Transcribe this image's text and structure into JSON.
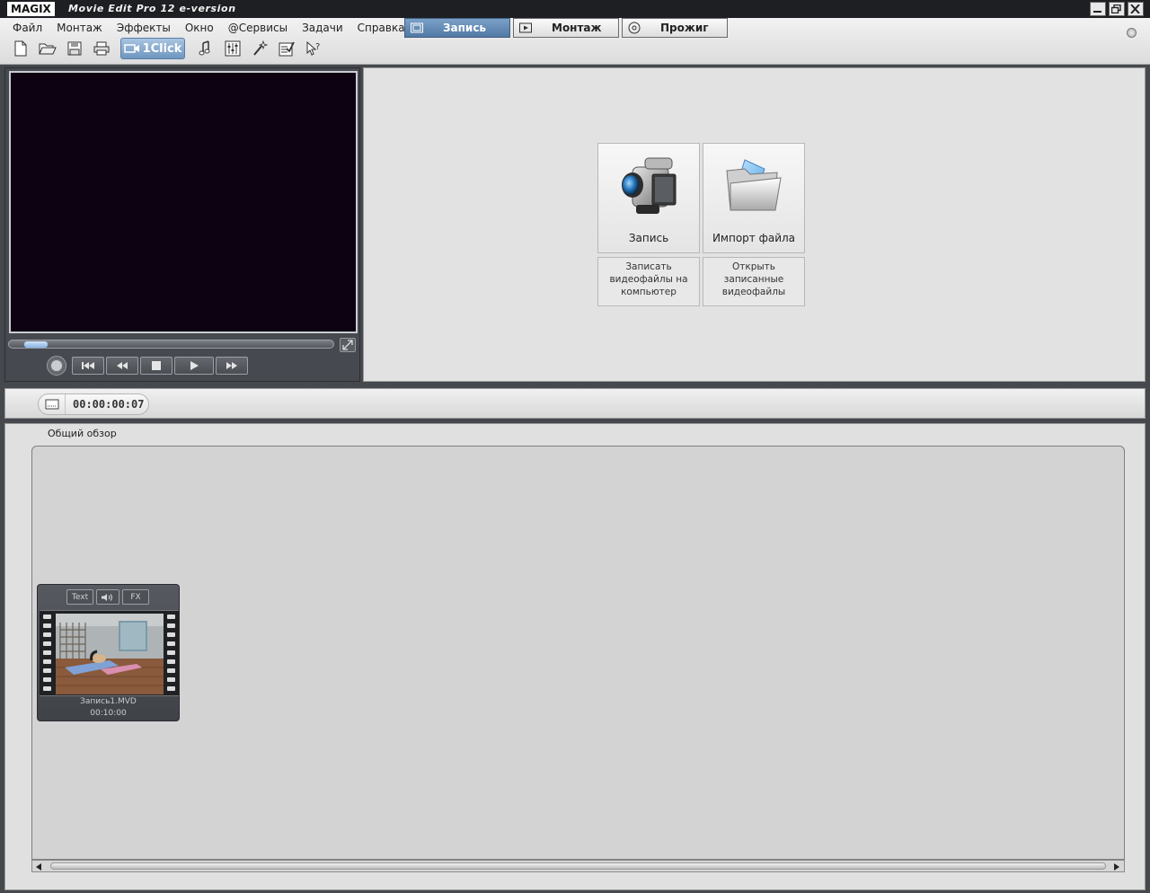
{
  "titlebar": {
    "logo": "MAGIX",
    "title": "Movie Edit Pro 12 e-version",
    "controls": [
      "minimize-icon",
      "restore-icon",
      "close-icon"
    ]
  },
  "menu": {
    "items": [
      "Файл",
      "Монтаж",
      "Эффекты",
      "Окно",
      "@Сервисы",
      "Задачи",
      "Справка"
    ]
  },
  "toolbar": {
    "icons": [
      "new-file-icon",
      "open-folder-icon",
      "save-icon",
      "print-icon"
    ],
    "oneclick_label": "1Click",
    "tools_icons": [
      "music-icon",
      "mixer-icon",
      "wizard-icon",
      "checklist-icon",
      "help-cursor-icon"
    ]
  },
  "mode_tabs": {
    "items": [
      {
        "label": "Запись",
        "icon": "film-icon",
        "active": true
      },
      {
        "label": "Монтаж",
        "icon": "play-icon",
        "active": false
      },
      {
        "label": "Прожиг",
        "icon": "disc-icon",
        "active": false
      }
    ]
  },
  "preview": {
    "scrub_position": 0.03,
    "transport_icons": [
      "record-icon",
      "go-to-start-icon",
      "rewind-icon",
      "stop-icon",
      "play-icon",
      "fast-forward-icon"
    ],
    "fullscreen_icon": "fullscreen-icon"
  },
  "actions": {
    "record": {
      "label": "Запись",
      "icon": "camcorder-icon",
      "description": "Записать видеофайлы на компьютер"
    },
    "import": {
      "label": "Импорт файла",
      "icon": "folder-icon",
      "description": "Открыть записанные видеофайлы"
    }
  },
  "timecode": {
    "value": "00:00:00:07",
    "icon": "display-mode-icon"
  },
  "storyboard": {
    "overview_label": "Общий обзор",
    "clips": [
      {
        "text_btn": "Text",
        "audio_icon": "speaker-icon",
        "fx_btn": "FX",
        "name": "Запись1.MVD",
        "duration": "00:10:00"
      }
    ]
  },
  "colors": {
    "accent_tab": "#5e86b2",
    "monitor_bg": "#0d0212",
    "panel_dark": "#464a50",
    "panel_light": "#e2e2e2"
  }
}
